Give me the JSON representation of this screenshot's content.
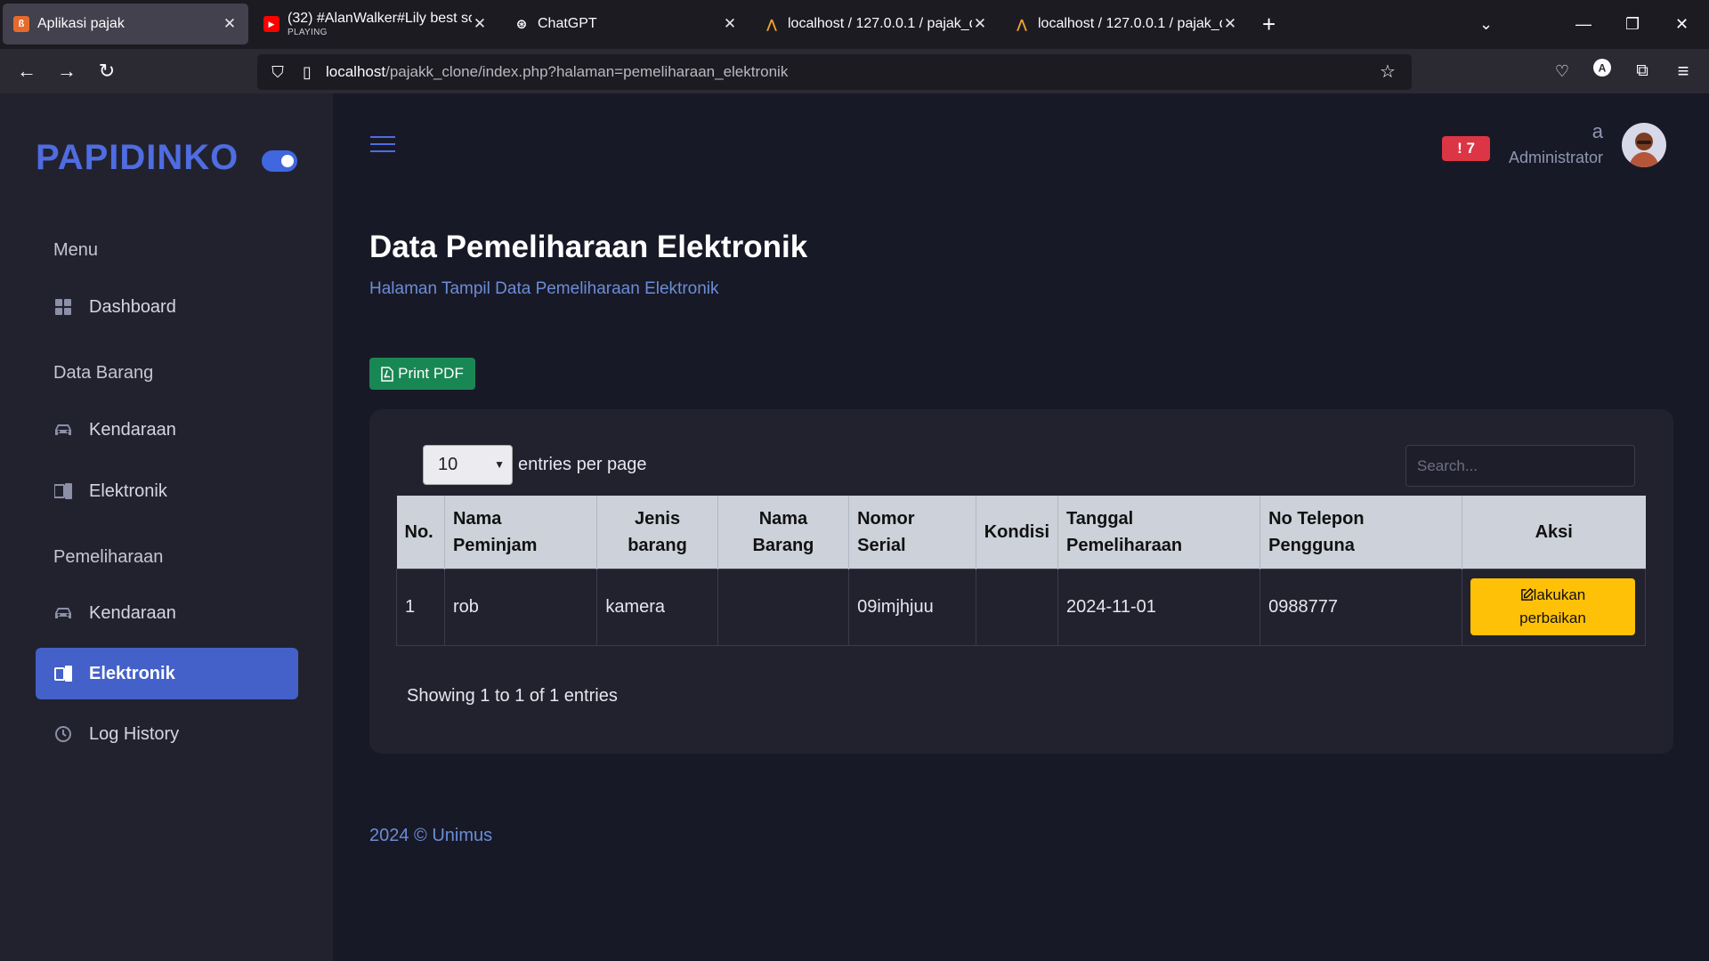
{
  "browser": {
    "tabs": [
      {
        "title": "Aplikasi pajak",
        "sub": ""
      },
      {
        "title": "(32) #AlanWalker#Lily best son",
        "sub": "PLAYING"
      },
      {
        "title": "ChatGPT",
        "sub": ""
      },
      {
        "title": "localhost / 127.0.0.1 / pajak_db",
        "sub": ""
      },
      {
        "title": "localhost / 127.0.0.1 / pajak_db",
        "sub": ""
      }
    ],
    "url_host": "localhost",
    "url_path": "/pajakk_clone/index.php?halaman=pemeliharaan_elektronik"
  },
  "sidebar": {
    "brand": "PAPIDINKO",
    "menu_heading": "Menu",
    "dashboard": "Dashboard",
    "data_barang_heading": "Data Barang",
    "kendaraan": "Kendaraan",
    "elektronik": "Elektronik",
    "pemeliharaan_heading": "Pemeliharaan",
    "pem_kendaraan": "Kendaraan",
    "pem_elektronik": "Elektronik",
    "log_history": "Log History"
  },
  "header": {
    "alert_count": "! 7",
    "user_name": "a",
    "user_role": "Administrator"
  },
  "main": {
    "title": "Data Pemeliharaan Elektronik",
    "subtitle": "Halaman Tampil Data Pemeliharaan Elektronik",
    "print_pdf": "Print PDF",
    "per_page_value": "10",
    "per_page_label": "entries per page",
    "search_placeholder": "Search...",
    "columns": [
      "No.",
      "Nama Peminjam",
      "Jenis barang",
      "Nama Barang",
      "Nomor Serial",
      "Kondisi",
      "Tanggal Pemeliharaan",
      "No Telepon Pengguna",
      "Aksi"
    ],
    "rows": [
      {
        "no": "1",
        "nama_peminjam": "rob",
        "jenis_barang": "kamera",
        "nama_barang": "",
        "nomor_serial": "09imjhjuu",
        "kondisi": "",
        "tanggal": "2024-11-01",
        "telepon": "0988777",
        "aksi": "lakukan perbaikan"
      }
    ],
    "showing": "Showing 1 to 1 of 1 entries"
  },
  "footer": "2024 © Unimus",
  "colors": {
    "brand": "#4f6ce0",
    "active_nav": "#4361c9",
    "pdf": "#198754",
    "action": "#ffc107",
    "alert": "#dc3545"
  }
}
